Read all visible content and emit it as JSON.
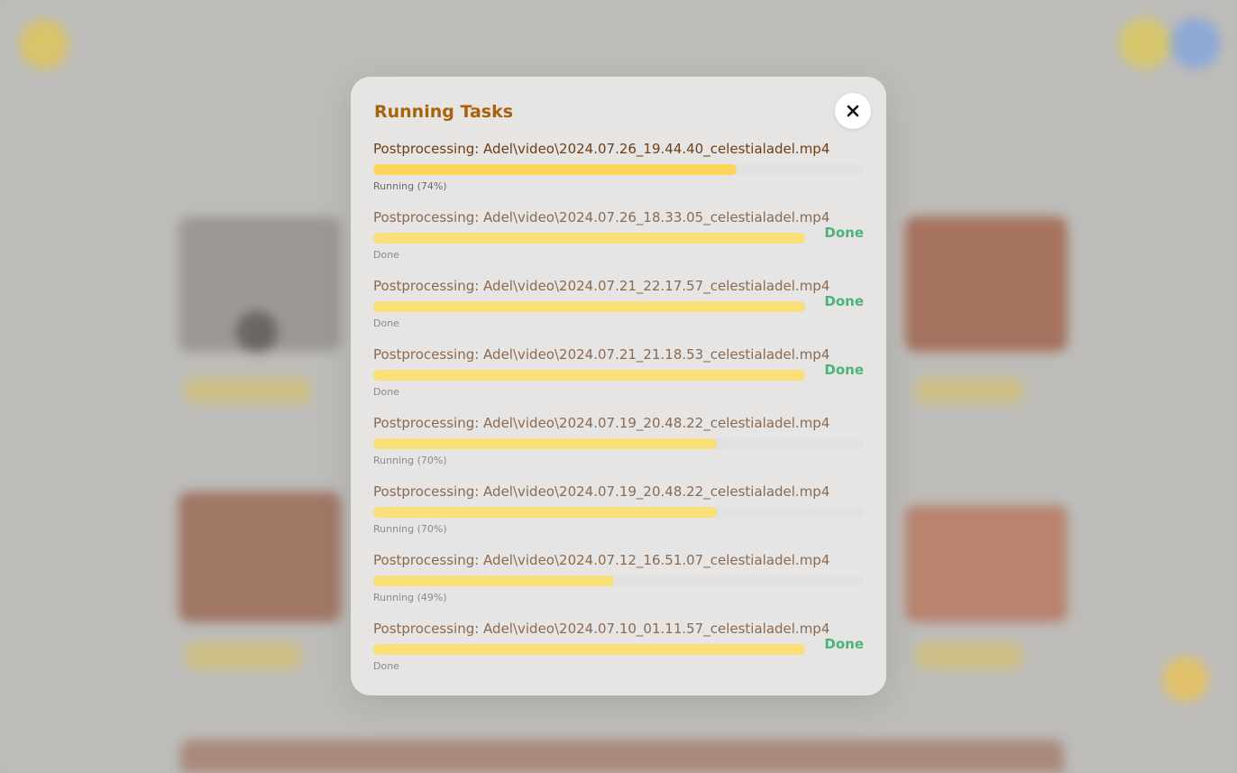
{
  "modal": {
    "title": "Running Tasks",
    "close_icon": "close-icon"
  },
  "tasks": [
    {
      "title": "Postprocessing: Adel\\video\\2024.07.26_19.44.40_celestialadel.mp4",
      "progress": 0.74,
      "status": "Running (74%)",
      "done_label": "",
      "active": true
    },
    {
      "title": "Postprocessing: Adel\\video\\2024.07.26_18.33.05_celestialadel.mp4",
      "progress": 1.0,
      "status": "Done",
      "done_label": "Done",
      "active": false
    },
    {
      "title": "Postprocessing: Adel\\video\\2024.07.21_22.17.57_celestialadel.mp4",
      "progress": 1.0,
      "status": "Done",
      "done_label": "Done",
      "active": false
    },
    {
      "title": "Postprocessing: Adel\\video\\2024.07.21_21.18.53_celestialadel.mp4",
      "progress": 1.0,
      "status": "Done",
      "done_label": "Done",
      "active": false
    },
    {
      "title": "Postprocessing: Adel\\video\\2024.07.19_20.48.22_celestialadel.mp4",
      "progress": 0.7,
      "status": "Running (70%)",
      "done_label": "",
      "active": false
    },
    {
      "title": "Postprocessing: Adel\\video\\2024.07.19_20.48.22_celestialadel.mp4",
      "progress": 0.7,
      "status": "Running (70%)",
      "done_label": "",
      "active": false
    },
    {
      "title": "Postprocessing: Adel\\video\\2024.07.12_16.51.07_celestialadel.mp4",
      "progress": 0.49,
      "status": "Running (49%)",
      "done_label": "",
      "active": false
    },
    {
      "title": "Postprocessing: Adel\\video\\2024.07.10_01.11.57_celestialadel.mp4",
      "progress": 1.0,
      "status": "Done",
      "done_label": "Done",
      "active": false
    }
  ],
  "colors": {
    "title": "#a8620c",
    "done": "#4cb47a",
    "bar_fill": "#f8df77",
    "bar_track": "#e2e1e1"
  }
}
